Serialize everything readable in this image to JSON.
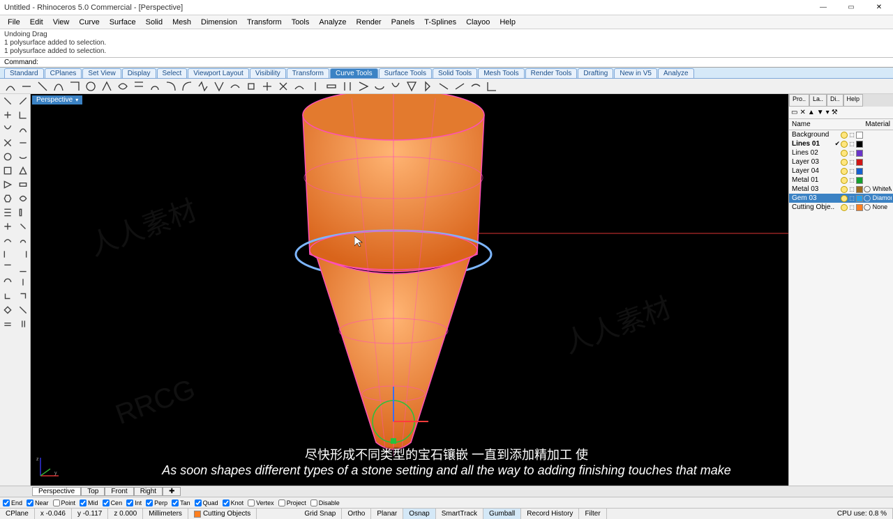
{
  "title": "Untitled - Rhinoceros 5.0 Commercial - [Perspective]",
  "menu": [
    "File",
    "Edit",
    "View",
    "Curve",
    "Surface",
    "Solid",
    "Mesh",
    "Dimension",
    "Transform",
    "Tools",
    "Analyze",
    "Render",
    "Panels",
    "T-Splines",
    "Clayoo",
    "Help"
  ],
  "cmd_history": [
    "Undoing Drag",
    "1 polysurface added to selection.",
    "1 polysurface added to selection."
  ],
  "cmd_label": "Command:",
  "tabs": [
    {
      "label": "Standard",
      "active": false
    },
    {
      "label": "CPlanes",
      "active": false
    },
    {
      "label": "Set View",
      "active": false
    },
    {
      "label": "Display",
      "active": false
    },
    {
      "label": "Select",
      "active": false
    },
    {
      "label": "Viewport Layout",
      "active": false
    },
    {
      "label": "Visibility",
      "active": false
    },
    {
      "label": "Transform",
      "active": false
    },
    {
      "label": "Curve Tools",
      "active": true
    },
    {
      "label": "Surface Tools",
      "active": false
    },
    {
      "label": "Solid Tools",
      "active": false
    },
    {
      "label": "Mesh Tools",
      "active": false
    },
    {
      "label": "Render Tools",
      "active": false
    },
    {
      "label": "Drafting",
      "active": false
    },
    {
      "label": "New in V5",
      "active": false
    },
    {
      "label": "Analyze",
      "active": false
    }
  ],
  "viewport_label": "Perspective",
  "panel_tabs": [
    "Pro..",
    "La..",
    "Di..",
    "Help"
  ],
  "panel_headers": {
    "name": "Name",
    "material": "Material"
  },
  "layers": [
    {
      "name": "Background",
      "color": "#ffffff",
      "mat": "",
      "sel": false,
      "check": false
    },
    {
      "name": "Lines 01",
      "color": "#000000",
      "mat": "",
      "sel": false,
      "check": true,
      "bold": true
    },
    {
      "name": "Lines 02",
      "color": "#6a34c9",
      "mat": "",
      "sel": false,
      "check": false
    },
    {
      "name": "Layer 03",
      "color": "#d01515",
      "mat": "",
      "sel": false,
      "check": false
    },
    {
      "name": "Layer 04",
      "color": "#1560d0",
      "mat": "",
      "sel": false,
      "check": false
    },
    {
      "name": "Metal 01",
      "color": "#15a02e",
      "mat": "",
      "sel": false,
      "check": false
    },
    {
      "name": "Metal 03",
      "color": "#9e6b1f",
      "mat": "WhiteMeta",
      "sel": false,
      "check": false
    },
    {
      "name": "Gem 03",
      "color": "#2aa0e8",
      "mat": "Diamond",
      "sel": true,
      "check": false
    },
    {
      "name": "Cutting Obje..",
      "color": "#ff7f1f",
      "mat": "None",
      "sel": false,
      "check": false
    }
  ],
  "view_tabs": [
    "Perspective",
    "Top",
    "Front",
    "Right"
  ],
  "osnap": [
    {
      "label": "End",
      "on": true
    },
    {
      "label": "Near",
      "on": true
    },
    {
      "label": "Point",
      "on": false
    },
    {
      "label": "Mid",
      "on": true
    },
    {
      "label": "Cen",
      "on": true
    },
    {
      "label": "Int",
      "on": true
    },
    {
      "label": "Perp",
      "on": true
    },
    {
      "label": "Tan",
      "on": true
    },
    {
      "label": "Quad",
      "on": true
    },
    {
      "label": "Knot",
      "on": true
    },
    {
      "label": "Vertex",
      "on": false
    },
    {
      "label": "Project",
      "on": false
    },
    {
      "label": "Disable",
      "on": false
    }
  ],
  "status": {
    "cplane": "CPlane",
    "x": "x -0.046",
    "y": "y -0.117",
    "z": "z 0.000",
    "units": "Millimeters",
    "layer": "Cutting Objects",
    "layer_color": "#ff7f1f",
    "toggles": [
      {
        "label": "Grid Snap",
        "on": false
      },
      {
        "label": "Ortho",
        "on": false
      },
      {
        "label": "Planar",
        "on": false
      },
      {
        "label": "Osnap",
        "on": true
      },
      {
        "label": "SmartTrack",
        "on": false
      },
      {
        "label": "Gumball",
        "on": true
      },
      {
        "label": "Record History",
        "on": false
      },
      {
        "label": "Filter",
        "on": false
      }
    ],
    "cpu": "CPU use: 0.8 %"
  },
  "subtitle_cn": "尽快形成不同类型的宝石镶嵌 一直到添加精加工 使",
  "subtitle_en": "As soon shapes different types of a stone setting and all the way to adding finishing touches that make"
}
